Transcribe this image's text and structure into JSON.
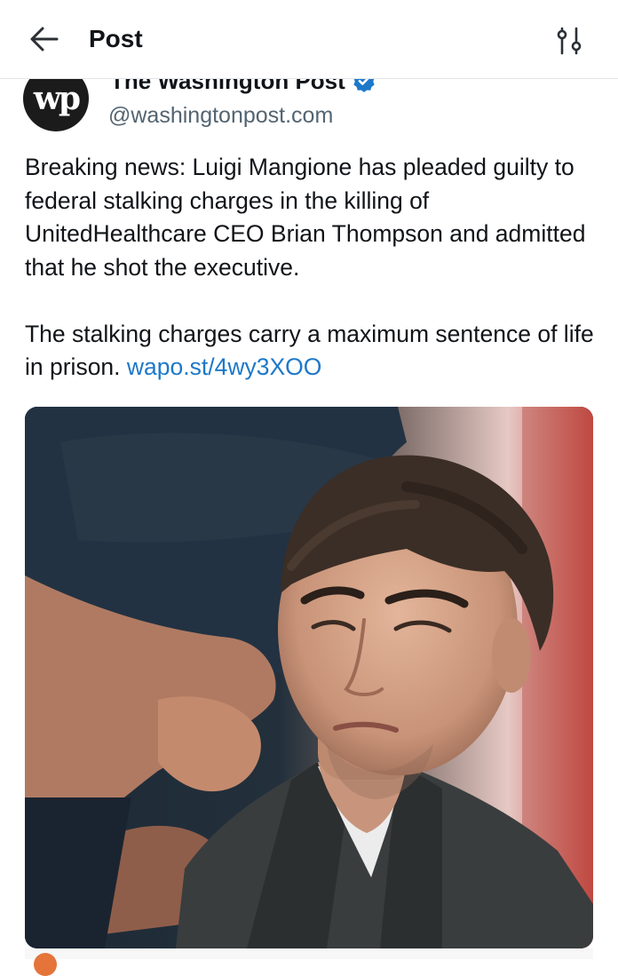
{
  "header": {
    "title": "Post",
    "back_icon": "arrow-left-icon",
    "filter_icon": "sliders-icon"
  },
  "author": {
    "avatar_text": "wp",
    "name": "The Washington Post",
    "handle": "@washingtonpost.com",
    "verified_icon": "verified-badge-icon",
    "verified_color": "#1d78c9"
  },
  "post": {
    "paragraph1": "Breaking news: Luigi Mangione has pleaded guilty to federal stalking charges in the killing of UnitedHealthcare CEO Brian Thompson and admitted that he shot the executive.",
    "paragraph2": "The stalking charges carry a maximum sentence of life in prison.",
    "link_text": "wapo.st/4wy3XOO",
    "link_color": "#1d78c9"
  },
  "media": {
    "type": "photo"
  }
}
